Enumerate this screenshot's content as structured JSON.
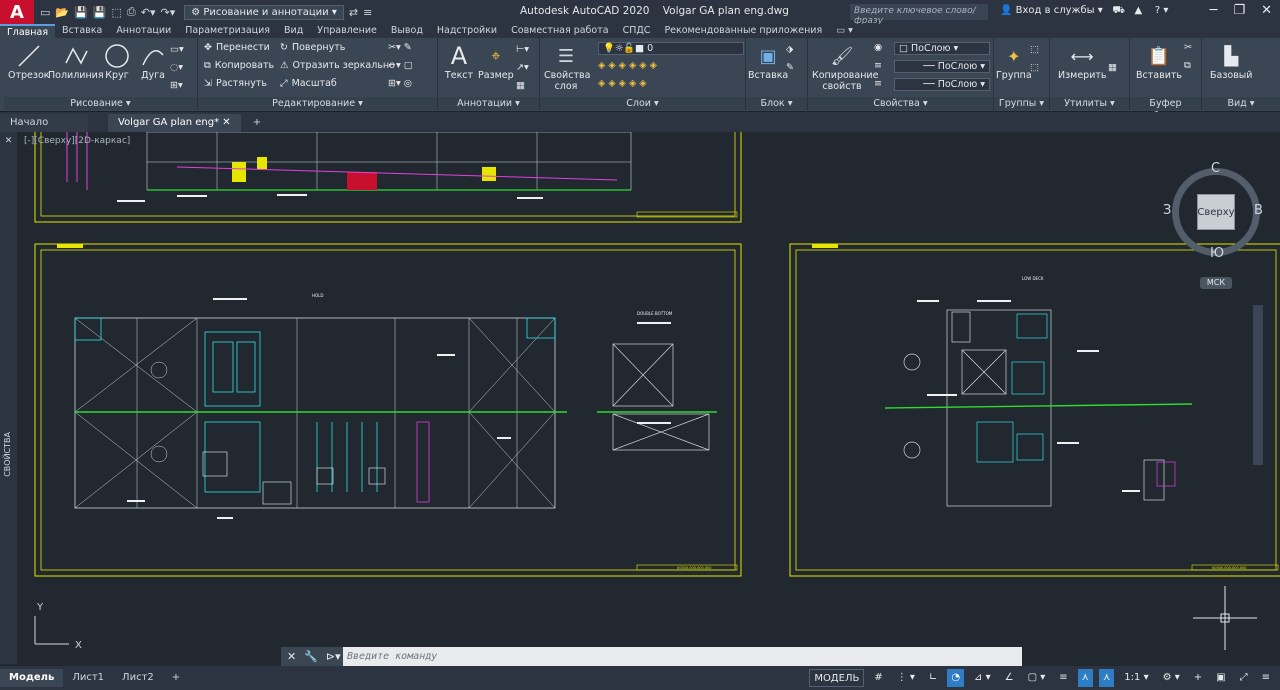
{
  "app": {
    "logo": "A",
    "title": "Autodesk AutoCAD 2020",
    "file": "Volgar GA plan eng.dwg",
    "workspace": "Рисование и аннотации",
    "search_placeholder": "Введите ключевое слово/фразу",
    "signin": "Вход в службы"
  },
  "ribbon_tabs": [
    "Главная",
    "Вставка",
    "Аннотации",
    "Параметризация",
    "Вид",
    "Управление",
    "Вывод",
    "Надстройки",
    "Совместная работа",
    "СПДС",
    "Рекомендованные приложения"
  ],
  "panels": {
    "draw": {
      "title": "Рисование",
      "buttons": [
        "Отрезок",
        "Полилиния",
        "Круг",
        "Дуга"
      ]
    },
    "modify": {
      "title": "Редактирование",
      "items": [
        "Перенести",
        "Повернуть",
        "Копировать",
        "Отразить зеркально",
        "Растянуть",
        "Масштаб"
      ]
    },
    "annotation": {
      "title": "Аннотации",
      "buttons": [
        "Текст",
        "Размер"
      ]
    },
    "layers": {
      "title": "Слои",
      "button": "Свойства слоя",
      "layer_value": "0"
    },
    "block": {
      "title": "Блок",
      "button": "Вставка"
    },
    "properties": {
      "title": "Свойства",
      "button": "Копирование свойств",
      "bylayer": [
        "ПоСлою",
        "ПоСлою",
        "ПоСлою"
      ]
    },
    "groups": {
      "title": "Группы",
      "button": "Группа"
    },
    "utilities": {
      "title": "Утилиты",
      "button": "Измерить"
    },
    "clipboard": {
      "title": "Буфер обмена",
      "button": "Вставить"
    },
    "view": {
      "title": "Вид",
      "button": "Базовый"
    }
  },
  "doc_tabs": [
    "Начало",
    "Volgar GA plan eng*"
  ],
  "viewport_label": "[-][Сверху][2D-каркас]",
  "viewcube": {
    "face": "Сверху",
    "n": "С",
    "s": "Ю",
    "w": "З",
    "e": "В",
    "ucs": "МСК"
  },
  "drawing_labels": {
    "hold": "HOLD",
    "double_bottom": "DOUBLE BOTTOM",
    "low_deck": "LOW DECK",
    "stamp1": "00500.000.000.000",
    "stamp2": "00500.000.000.000",
    "stamp3": "00500.000.000.000"
  },
  "command": {
    "placeholder": "Введите команду"
  },
  "layout_tabs": [
    "Модель",
    "Лист1",
    "Лист2"
  ],
  "status": {
    "model": "МОДЕЛЬ",
    "scale": "1:1"
  },
  "colors": {
    "frame": "#e6e600",
    "accent": "#2f7dc5"
  }
}
